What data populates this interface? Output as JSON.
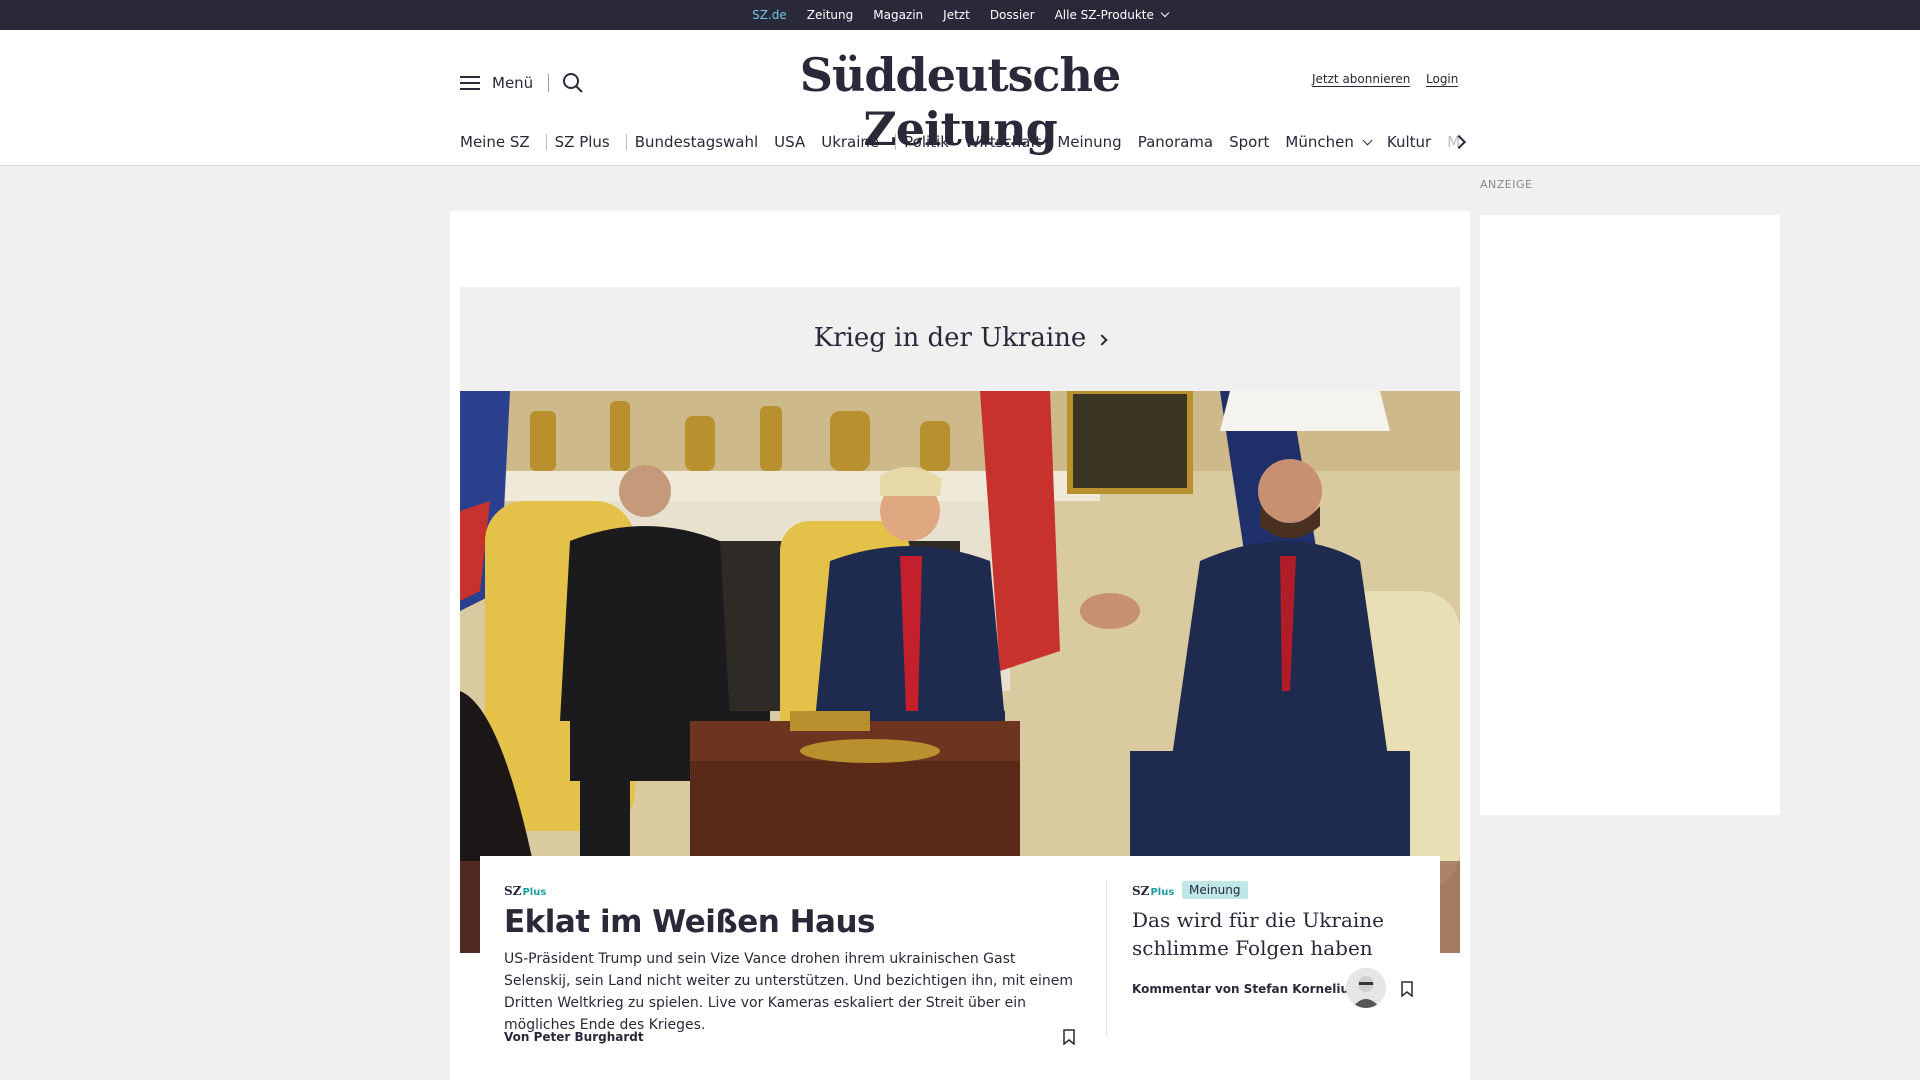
{
  "topbar": {
    "items": [
      "SZ.de",
      "Zeitung",
      "Magazin",
      "Jetzt",
      "Dossier",
      "Alle SZ-Produkte"
    ]
  },
  "header": {
    "menu_label": "Menü",
    "logo": "Süddeutsche Zeitung",
    "subscribe": "Jetzt abonnieren",
    "login": "Login"
  },
  "nav": {
    "items": [
      "Meine SZ",
      "SZ Plus",
      "Bundestagswahl",
      "USA",
      "Ukraine",
      "Politik",
      "Wirtschaft",
      "Meinung",
      "Panorama",
      "Sport",
      "München",
      "Kultur"
    ],
    "truncated": "M"
  },
  "ad": {
    "label": "ANZEIGE"
  },
  "section": {
    "title": "Krieg in der Ukraine"
  },
  "lead": {
    "brand": "SZ",
    "brand_plus": "Plus",
    "title": "Eklat im Weißen Haus",
    "text": "US-Präsident Trump und sein Vize Vance drohen ihrem ukrainischen Gast Selenskij, sein Land nicht weiter zu unterstützen. Und bezichtigen ihn, mit einem Dritten Weltkrieg zu spielen. Live vor Kameras eskaliert der Streit über ein mögliches Ende des Krieges.",
    "author": "Von Peter Burghardt"
  },
  "side": {
    "brand": "SZ",
    "brand_plus": "Plus",
    "badge": "Meinung",
    "title": "Das wird für die Ukraine schlimme Folgen haben",
    "author": "Kommentar von Stefan Kornelius"
  },
  "colors": {
    "topbar": "#29293a",
    "active_link": "#71c5e8",
    "plus_accent": "#1a9fa0",
    "badge_bg": "#bfe7e8",
    "page_bg": "#f0f0f0"
  }
}
